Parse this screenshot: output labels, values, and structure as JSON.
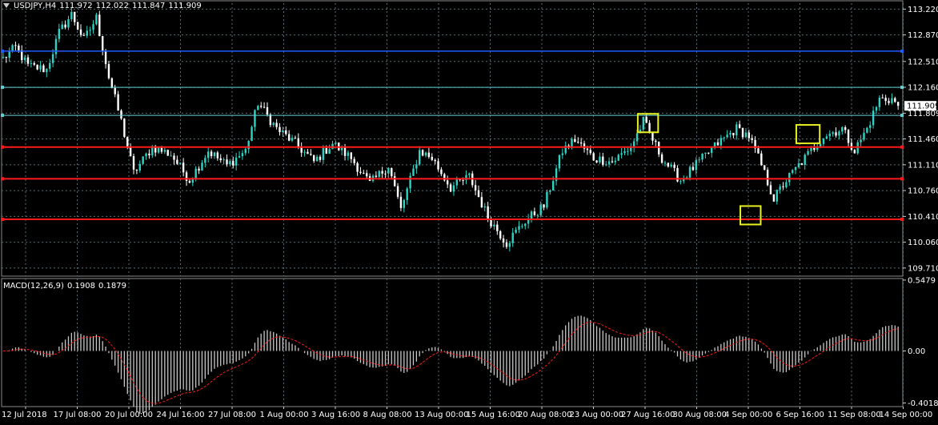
{
  "header": {
    "symbol": "USDJPY,H4",
    "open": "111.972",
    "high": "112.022",
    "low": "111.847",
    "close": "111.909"
  },
  "macd_header": {
    "label": "MACD(12,26,9)",
    "value1": "0.1908",
    "value2": "0.1879"
  },
  "colors": {
    "background": "#000000",
    "grid": "#5a6c73",
    "bull": "#2fd3c4",
    "bear": "#ffffff",
    "support": "#ff1a1a",
    "resistance_blue": "#1e5cff",
    "resistance_cyan": "#5fd0d8",
    "highlight": "#e8f020",
    "macd_signal": "#ff1a1a",
    "macd_hist": "#c8c8c8",
    "text": "#ffffff"
  },
  "chart_data": [
    {
      "type": "candlestick",
      "title": "USDJPY,H4",
      "ylim": [
        109.6,
        113.3
      ],
      "y_ticks": [
        "113.220",
        "112.870",
        "112.510",
        "112.160",
        "111.809",
        "111.460",
        "111.110",
        "110.760",
        "110.410",
        "110.060",
        "109.710"
      ],
      "current_price": "111.909",
      "x_tick_labels": [
        "12 Jul 2018",
        "17 Jul 08:00",
        "20 Jul 00:00",
        "24 Jul 16:00",
        "27 Jul 08:00",
        "1 Aug 00:00",
        "3 Aug 16:00",
        "8 Aug 08:00",
        "13 Aug 00:00",
        "15 Aug 16:00",
        "20 Aug 08:00",
        "23 Aug 00:00",
        "27 Aug 16:00",
        "30 Aug 08:00",
        "4 Sep 00:00",
        "6 Sep 16:00",
        "11 Sep 08:00",
        "14 Sep 00:00"
      ],
      "anchors": [
        {
          "i": 0,
          "p": 112.55
        },
        {
          "i": 4,
          "p": 112.7
        },
        {
          "i": 8,
          "p": 112.45
        },
        {
          "i": 14,
          "p": 112.4
        },
        {
          "i": 18,
          "p": 112.9
        },
        {
          "i": 22,
          "p": 113.15
        },
        {
          "i": 26,
          "p": 112.8
        },
        {
          "i": 30,
          "p": 113.1
        },
        {
          "i": 34,
          "p": 112.3
        },
        {
          "i": 38,
          "p": 111.7
        },
        {
          "i": 42,
          "p": 111.0
        },
        {
          "i": 48,
          "p": 111.35
        },
        {
          "i": 54,
          "p": 111.25
        },
        {
          "i": 60,
          "p": 110.9
        },
        {
          "i": 66,
          "p": 111.3
        },
        {
          "i": 72,
          "p": 111.1
        },
        {
          "i": 78,
          "p": 111.3
        },
        {
          "i": 82,
          "p": 111.95
        },
        {
          "i": 88,
          "p": 111.6
        },
        {
          "i": 94,
          "p": 111.4
        },
        {
          "i": 100,
          "p": 111.15
        },
        {
          "i": 106,
          "p": 111.4
        },
        {
          "i": 112,
          "p": 111.2
        },
        {
          "i": 118,
          "p": 110.85
        },
        {
          "i": 124,
          "p": 111.1
        },
        {
          "i": 128,
          "p": 110.5
        },
        {
          "i": 134,
          "p": 111.3
        },
        {
          "i": 138,
          "p": 111.2
        },
        {
          "i": 144,
          "p": 110.8
        },
        {
          "i": 150,
          "p": 110.95
        },
        {
          "i": 156,
          "p": 110.4
        },
        {
          "i": 162,
          "p": 110.05
        },
        {
          "i": 168,
          "p": 110.35
        },
        {
          "i": 174,
          "p": 110.55
        },
        {
          "i": 180,
          "p": 111.3
        },
        {
          "i": 184,
          "p": 111.45
        },
        {
          "i": 190,
          "p": 111.2
        },
        {
          "i": 196,
          "p": 111.15
        },
        {
          "i": 202,
          "p": 111.35
        },
        {
          "i": 206,
          "p": 111.7
        },
        {
          "i": 212,
          "p": 111.2
        },
        {
          "i": 218,
          "p": 110.9
        },
        {
          "i": 224,
          "p": 111.15
        },
        {
          "i": 230,
          "p": 111.4
        },
        {
          "i": 236,
          "p": 111.6
        },
        {
          "i": 240,
          "p": 111.5
        },
        {
          "i": 244,
          "p": 111.1
        },
        {
          "i": 248,
          "p": 110.65
        },
        {
          "i": 252,
          "p": 110.9
        },
        {
          "i": 258,
          "p": 111.2
        },
        {
          "i": 264,
          "p": 111.5
        },
        {
          "i": 270,
          "p": 111.6
        },
        {
          "i": 274,
          "p": 111.3
        },
        {
          "i": 278,
          "p": 111.6
        },
        {
          "i": 282,
          "p": 112.0
        },
        {
          "i": 286,
          "p": 112.0
        },
        {
          "i": 288,
          "p": 111.909
        }
      ],
      "levels": [
        {
          "price": 112.65,
          "style": "blue"
        },
        {
          "price": 112.16,
          "style": "cyan"
        },
        {
          "price": 111.78,
          "style": "cyan"
        },
        {
          "price": 111.35,
          "style": "red"
        },
        {
          "price": 110.92,
          "style": "red"
        },
        {
          "price": 110.37,
          "style": "red"
        }
      ],
      "highlight_boxes": [
        {
          "i0": 205,
          "i1": 210,
          "p0": 111.55,
          "p1": 111.8
        },
        {
          "i0": 256,
          "i1": 262,
          "p0": 111.4,
          "p1": 111.65
        },
        {
          "i0": 238,
          "i1": 243,
          "p0": 110.3,
          "p1": 110.55
        }
      ]
    },
    {
      "type": "histogram",
      "title": "MACD(12,26,9)",
      "ylim": [
        -0.43,
        0.56
      ],
      "y_ticks": [
        "0.5479",
        "0.00",
        "-0.4018"
      ]
    }
  ]
}
